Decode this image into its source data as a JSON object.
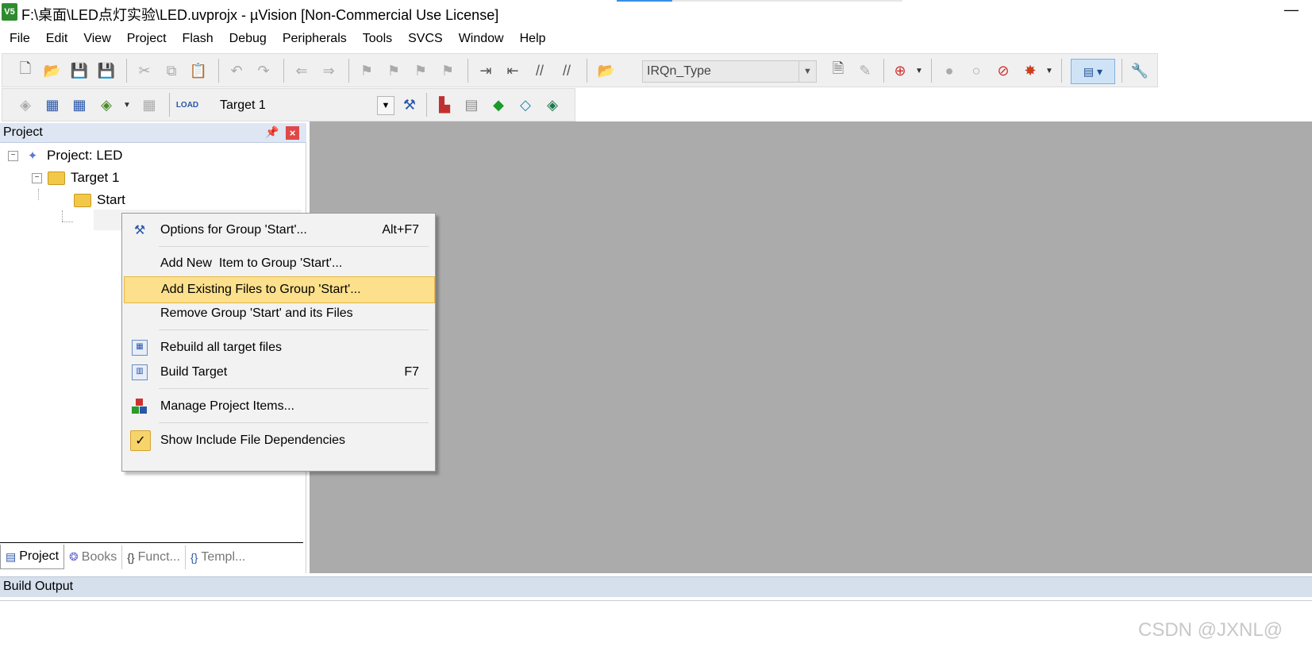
{
  "window": {
    "title": "F:\\桌面\\LED点灯实验\\LED.uvprojx - µVision  [Non-Commercial Use License]",
    "app_icon": "V5",
    "minimize_glyph": "—"
  },
  "menubar": {
    "items": [
      "File",
      "Edit",
      "View",
      "Project",
      "Flash",
      "Debug",
      "Peripherals",
      "Tools",
      "SVCS",
      "Window",
      "Help"
    ]
  },
  "toolbar": {
    "find_combo_value": "IRQn_Type",
    "target_combo_value": "Target 1"
  },
  "project_panel": {
    "title": "Project",
    "pin_glyph": "📌",
    "close_glyph": "×",
    "tree": {
      "root": "Project: LED",
      "target": "Target 1",
      "group": "Start"
    },
    "tabs": [
      "Project",
      "Books",
      "Funct...",
      "Templ..."
    ],
    "active_tab": "Project"
  },
  "context_menu": {
    "items": [
      {
        "label": "Options for Group 'Start'...",
        "shortcut": "Alt+F7",
        "icon": "magic-wand-icon"
      },
      {
        "label": "Add New  Item to Group 'Start'...",
        "shortcut": "",
        "icon": ""
      },
      {
        "label": "Add Existing Files to Group 'Start'...",
        "shortcut": "",
        "icon": "",
        "highlighted": true
      },
      {
        "label": "Remove Group 'Start' and its Files",
        "shortcut": "",
        "icon": ""
      },
      {
        "label": "Rebuild all target files",
        "shortcut": "",
        "icon": "rebuild-icon"
      },
      {
        "label": "Build Target",
        "shortcut": "F7",
        "icon": "build-icon"
      },
      {
        "label": "Manage Project Items...",
        "shortcut": "",
        "icon": "manage-items-icon"
      },
      {
        "label": "Show Include File Dependencies",
        "shortcut": "",
        "icon": "checkmark-icon",
        "checked": true
      }
    ]
  },
  "build_output": {
    "title": "Build Output"
  },
  "watermark": "CSDN @JXNL@",
  "colors": {
    "editor_background": "#ababab",
    "panel_header": "#dde6f2",
    "menu_highlight": "#fde08c",
    "close_red": "#e04848"
  }
}
